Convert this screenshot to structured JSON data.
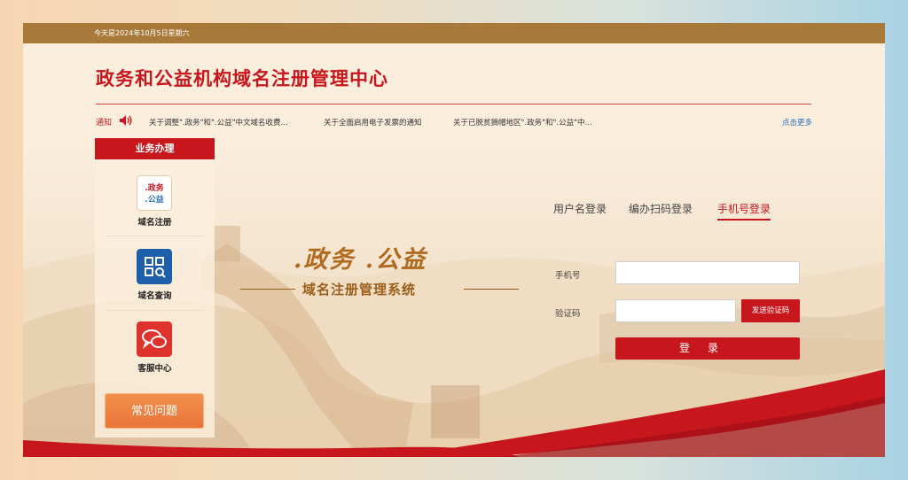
{
  "topbar": {
    "date": "今天是2024年10月5日星期六"
  },
  "header": {
    "title": "政务和公益机构域名注册管理中心"
  },
  "notice": {
    "label": "通知",
    "items": [
      "关于调整\".政务\"和\".公益\"中文域名收费...",
      "关于全面启用电子发票的通知",
      "关于已脱贫摘帽地区\".政务\"和\".公益\"中..."
    ],
    "more": "点击更多"
  },
  "sidebar": {
    "title": "业务办理",
    "items": [
      {
        "label": "域名注册",
        "icon": "domain-register-icon",
        "icon_text_1": ".政务",
        "icon_text_2": ".公益"
      },
      {
        "label": "域名查询",
        "icon": "qr-search-icon"
      },
      {
        "label": "客服中心",
        "icon": "chat-bubbles-icon"
      }
    ],
    "faq": "常见问题"
  },
  "banner": {
    "brand": ".政务 .公益",
    "subtitle": "域名注册管理系统"
  },
  "login": {
    "tabs": [
      "用户名登录",
      "编办扫码登录",
      "手机号登录"
    ],
    "active_tab": "手机号登录",
    "phone_label": "手机号",
    "phone_value": "",
    "code_label": "验证码",
    "code_value": "",
    "send_code": "发送验证码",
    "submit": "登录"
  },
  "colors": {
    "accent": "#c8161d",
    "topbar": "#a87938",
    "faq": "#ea7a3c",
    "brand_gold": "#b06a1e"
  }
}
